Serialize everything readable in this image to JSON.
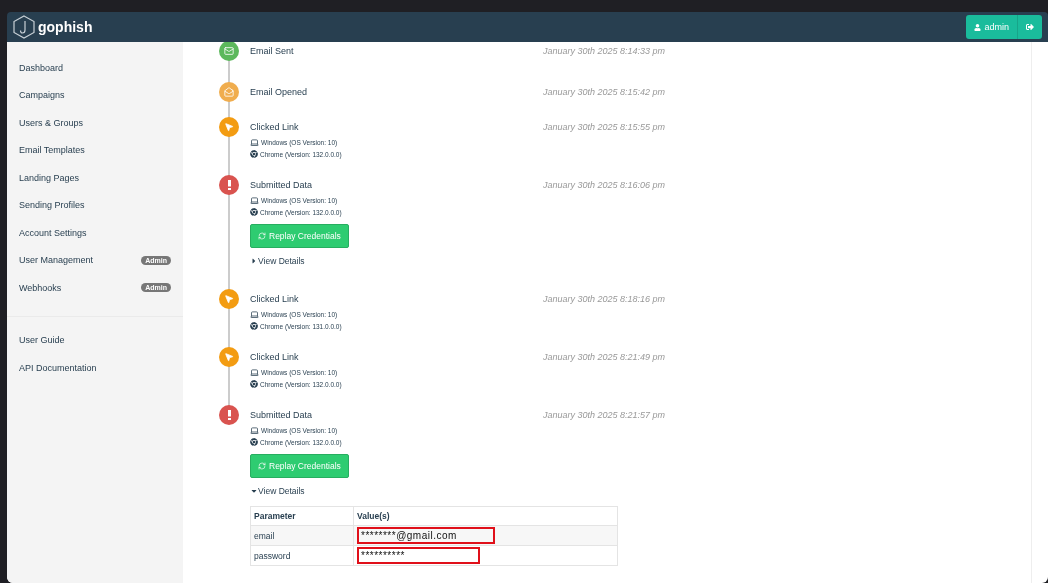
{
  "navbar": {
    "brand": "gophish",
    "user_button": "admin"
  },
  "sidebar": {
    "items": [
      {
        "label": "Dashboard"
      },
      {
        "label": "Campaigns"
      },
      {
        "label": "Users & Groups"
      },
      {
        "label": "Email Templates"
      },
      {
        "label": "Landing Pages"
      },
      {
        "label": "Sending Profiles"
      },
      {
        "label": "Account Settings"
      },
      {
        "label": "User Management",
        "badge": "Admin"
      },
      {
        "label": "Webhooks",
        "badge": "Admin"
      }
    ],
    "footer_items": [
      {
        "label": "User Guide"
      },
      {
        "label": "API Documentation"
      }
    ]
  },
  "timeline": [
    {
      "kind": "sent",
      "title": "Email Sent",
      "time": "January 30th 2025 8:14:33 pm"
    },
    {
      "kind": "opened",
      "title": "Email Opened",
      "time": "January 30th 2025 8:15:42 pm"
    },
    {
      "kind": "clicked",
      "title": "Clicked Link",
      "time": "January 30th 2025 8:15:55 pm",
      "os": "Windows (OS Version: 10)",
      "browser": "Chrome (Version: 132.0.0.0)"
    },
    {
      "kind": "submitted",
      "title": "Submitted Data",
      "time": "January 30th 2025 8:16:06 pm",
      "os": "Windows (OS Version: 10)",
      "browser": "Chrome (Version: 132.0.0.0)",
      "replay_button": "Replay Credentials",
      "details": {
        "label": "View Details",
        "expanded": false
      }
    },
    {
      "kind": "clicked",
      "title": "Clicked Link",
      "time": "January 30th 2025 8:18:16 pm",
      "os": "Windows (OS Version: 10)",
      "browser": "Chrome (Version: 131.0.0.0)"
    },
    {
      "kind": "clicked",
      "title": "Clicked Link",
      "time": "January 30th 2025 8:21:49 pm",
      "os": "Windows (OS Version: 10)",
      "browser": "Chrome (Version: 132.0.0.0)"
    },
    {
      "kind": "submitted",
      "title": "Submitted Data",
      "time": "January 30th 2025 8:21:57 pm",
      "os": "Windows (OS Version: 10)",
      "browser": "Chrome (Version: 132.0.0.0)",
      "replay_button": "Replay Credentials",
      "details": {
        "label": "View Details",
        "expanded": true,
        "columns": [
          "Parameter",
          "Value(s)"
        ],
        "rows": [
          {
            "parameter": "email",
            "value": "********@gmail.com",
            "highlighted": true
          },
          {
            "parameter": "password",
            "value": "**********",
            "highlighted": true
          }
        ]
      }
    }
  ]
}
